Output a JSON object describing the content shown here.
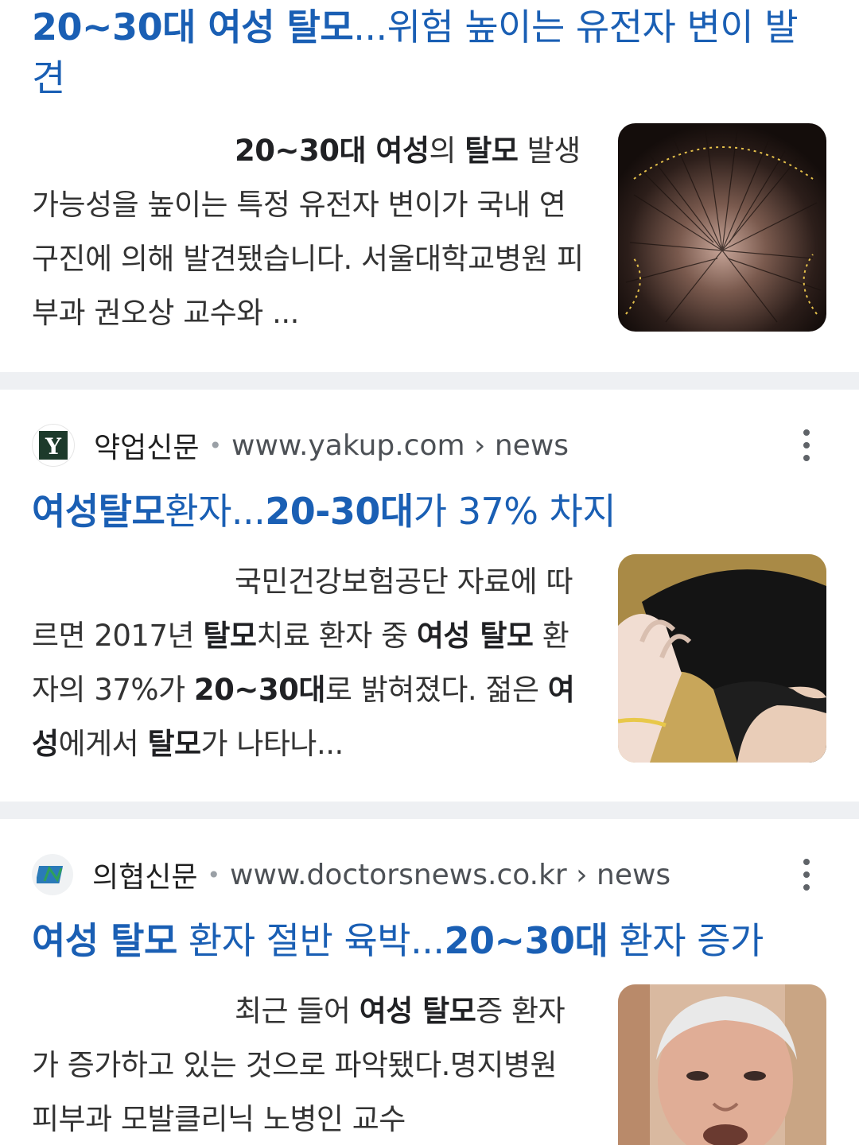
{
  "results": [
    {
      "title_segments": [
        {
          "text": "20~30대 여성 탈모",
          "bold": true
        },
        {
          "text": "...위험 높이는 유전자 변이 발견",
          "bold": false
        }
      ],
      "snippet_segments": [
        {
          "text": "20~30대 여성",
          "bold": true
        },
        {
          "text": "의 ",
          "bold": false
        },
        {
          "text": "탈모",
          "bold": true
        },
        {
          "text": " 발생 가능성을 높이는 특정 유전자 변이가 국내 연구진에 의해 발견됐습니다. 서울대학교병원 피부과 권오상 교수와 ...",
          "bold": false
        }
      ],
      "thumbnail": "scalp-hair-loss-photo"
    },
    {
      "source": {
        "name": "약업신문",
        "url": "www.yakup.com › news",
        "favicon": "yakup-y-logo-icon",
        "favicon_letter": "Y"
      },
      "title_segments": [
        {
          "text": "여성탈모",
          "bold": true
        },
        {
          "text": "환자...",
          "bold": false
        },
        {
          "text": "20-30대",
          "bold": true
        },
        {
          "text": "가 37% 차지",
          "bold": false
        }
      ],
      "snippet_segments": [
        {
          "text": "국민건강보험공단 자료에 따르면 2017년 ",
          "bold": false
        },
        {
          "text": "탈모",
          "bold": true
        },
        {
          "text": "치료 환자 중 ",
          "bold": false
        },
        {
          "text": "여성 탈모",
          "bold": true
        },
        {
          "text": " 환자의 37%가 ",
          "bold": false
        },
        {
          "text": "20~30대",
          "bold": true
        },
        {
          "text": "로 밝혀졌다. 젊은 ",
          "bold": false
        },
        {
          "text": "여성",
          "bold": true
        },
        {
          "text": "에게서 ",
          "bold": false
        },
        {
          "text": "탈모",
          "bold": true
        },
        {
          "text": "가 나타나...",
          "bold": false
        }
      ],
      "thumbnail": "woman-hairline-photo"
    },
    {
      "source": {
        "name": "의협신문",
        "url": "www.doctorsnews.co.kr › news",
        "favicon": "doctorsnews-logo-icon"
      },
      "title_segments": [
        {
          "text": "여성 탈모",
          "bold": true
        },
        {
          "text": " 환자 절반 육박...",
          "bold": false
        },
        {
          "text": "20~30대",
          "bold": true
        },
        {
          "text": " 환자 증가",
          "bold": false
        }
      ],
      "snippet_segments": [
        {
          "text": "최근 들어 ",
          "bold": false
        },
        {
          "text": "여성 탈모",
          "bold": true
        },
        {
          "text": "증 환자가 증가하고 있는 것으로 파악됐다.명지병원 피부과 모발클리닉 노병인 교수",
          "bold": false
        }
      ],
      "thumbnail": "professor-portrait-photo"
    }
  ],
  "colors": {
    "title_link": "#1a5fb4",
    "snippet_text": "#333333",
    "separator": "#eef0f3",
    "url_text": "#4d5156"
  }
}
